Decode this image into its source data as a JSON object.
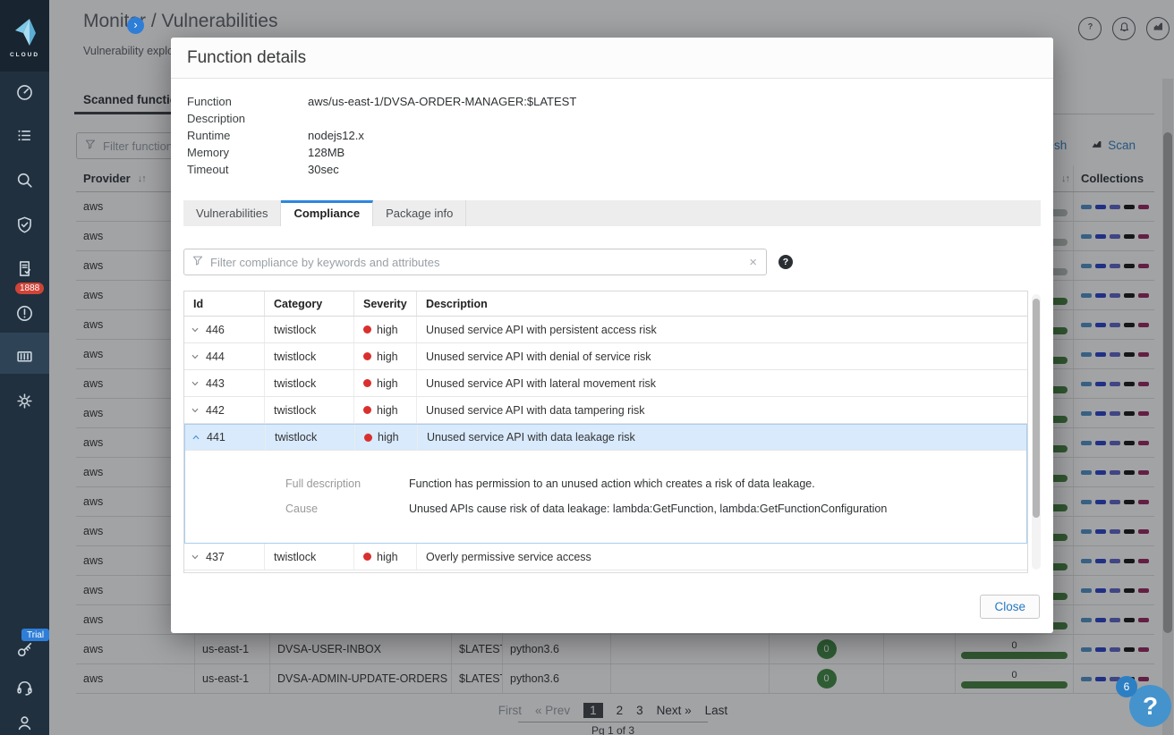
{
  "colors": {
    "accent_blue": "#2b87e0",
    "link_blue": "#2f7fc1",
    "severity_high_red": "#d9302e",
    "success_green": "#3e8a42",
    "bar_green": "#44803f",
    "bar_gray": "#b9c2bd",
    "collections_palette": [
      "#4f91c9",
      "#2840c8",
      "#5c63c8",
      "#141414",
      "#97245d"
    ]
  },
  "sidebar": {
    "logo_label": "CLOUD",
    "expand_chevron": "›",
    "alerts_badge": "1888",
    "trial_badge": "Trial",
    "nav_icons": [
      "gauge-icon",
      "checklist-icon",
      "search-icon",
      "shield-check-icon",
      "document-check-icon",
      "alert-circle-icon",
      "containers-icon",
      "gear-icon"
    ],
    "footer_icons": [
      "key-icon",
      "headset-icon",
      "user-icon"
    ]
  },
  "header": {
    "title": "Monitor / Vulnerabilities",
    "subtitle": "Vulnerability explorer",
    "action_icons": [
      "help-icon",
      "bell-icon",
      "stats-icon"
    ]
  },
  "background": {
    "tab_label": "Scanned functions",
    "filter_placeholder": "Filter functions by keywords and attributes",
    "refresh_label": "Refresh",
    "scan_label": "Scan",
    "table": {
      "provider_header": "Provider",
      "collections_header": "Collections",
      "sort_glyph": "↓↑",
      "rows": [
        {
          "provider": "aws",
          "region": "",
          "name": "",
          "version": "",
          "runtime": "",
          "issues": "",
          "bar": "gray",
          "bar_label": ""
        },
        {
          "provider": "aws",
          "region": "",
          "name": "",
          "version": "",
          "runtime": "",
          "issues": "",
          "bar": "gray",
          "bar_label": ""
        },
        {
          "provider": "aws",
          "region": "",
          "name": "",
          "version": "",
          "runtime": "",
          "issues": "",
          "bar": "gray",
          "bar_label": ""
        },
        {
          "provider": "aws",
          "region": "",
          "name": "",
          "version": "",
          "runtime": "",
          "issues": "",
          "bar": "green",
          "bar_label": ""
        },
        {
          "provider": "aws",
          "region": "",
          "name": "",
          "version": "",
          "runtime": "",
          "issues": "",
          "bar": "green",
          "bar_label": ""
        },
        {
          "provider": "aws",
          "region": "",
          "name": "",
          "version": "",
          "runtime": "",
          "issues": "",
          "bar": "green",
          "bar_label": ""
        },
        {
          "provider": "aws",
          "region": "",
          "name": "",
          "version": "",
          "runtime": "",
          "issues": "",
          "bar": "green",
          "bar_label": ""
        },
        {
          "provider": "aws",
          "region": "",
          "name": "",
          "version": "",
          "runtime": "",
          "issues": "",
          "bar": "green",
          "bar_label": ""
        },
        {
          "provider": "aws",
          "region": "",
          "name": "",
          "version": "",
          "runtime": "",
          "issues": "",
          "bar": "green",
          "bar_label": ""
        },
        {
          "provider": "aws",
          "region": "",
          "name": "",
          "version": "",
          "runtime": "",
          "issues": "",
          "bar": "green",
          "bar_label": ""
        },
        {
          "provider": "aws",
          "region": "",
          "name": "",
          "version": "",
          "runtime": "",
          "issues": "",
          "bar": "green",
          "bar_label": ""
        },
        {
          "provider": "aws",
          "region": "",
          "name": "",
          "version": "",
          "runtime": "",
          "issues": "",
          "bar": "green",
          "bar_label": ""
        },
        {
          "provider": "aws",
          "region": "",
          "name": "",
          "version": "",
          "runtime": "",
          "issues": "",
          "bar": "green",
          "bar_label": ""
        },
        {
          "provider": "aws",
          "region": "",
          "name": "",
          "version": "",
          "runtime": "",
          "issues": "",
          "bar": "green",
          "bar_label": ""
        },
        {
          "provider": "aws",
          "region": "",
          "name": "",
          "version": "",
          "runtime": "",
          "issues": "",
          "bar": "green",
          "bar_label": ""
        },
        {
          "provider": "aws",
          "region": "us-east-1",
          "name": "DVSA-USER-INBOX",
          "version": "$LATEST",
          "runtime": "python3.6",
          "issues": "0",
          "bar": "green",
          "bar_label": "0"
        },
        {
          "provider": "aws",
          "region": "us-east-1",
          "name": "DVSA-ADMIN-UPDATE-ORDERS",
          "version": "$LATEST",
          "runtime": "python3.6",
          "issues": "0",
          "bar": "green",
          "bar_label": "0"
        }
      ]
    },
    "pagination": {
      "first": "First",
      "prev": "« Prev",
      "pages": [
        "1",
        "2",
        "3"
      ],
      "active_page": "1",
      "next": "Next »",
      "last": "Last",
      "status": "Pg 1 of 3"
    }
  },
  "modal": {
    "title": "Function details",
    "details": [
      {
        "label": "Function",
        "value": "aws/us-east-1/DVSA-ORDER-MANAGER:$LATEST"
      },
      {
        "label": "Description",
        "value": ""
      },
      {
        "label": "Runtime",
        "value": "nodejs12.x"
      },
      {
        "label": "Memory",
        "value": "128MB"
      },
      {
        "label": "Timeout",
        "value": "30sec"
      }
    ],
    "tabs": [
      {
        "label": "Vulnerabilities",
        "active": false
      },
      {
        "label": "Compliance",
        "active": true
      },
      {
        "label": "Package info",
        "active": false
      }
    ],
    "filter_placeholder": "Filter compliance by keywords and attributes",
    "clear_glyph": "×",
    "help_glyph": "?",
    "compliance": {
      "headers": [
        "Id",
        "Category",
        "Severity",
        "Description"
      ],
      "detail_labels": {
        "full_description": "Full description",
        "cause": "Cause"
      },
      "rows": [
        {
          "id": "446",
          "category": "twistlock",
          "severity": "high",
          "description": "Unused service API with persistent access risk",
          "expanded": false
        },
        {
          "id": "444",
          "category": "twistlock",
          "severity": "high",
          "description": "Unused service API with denial of service risk",
          "expanded": false
        },
        {
          "id": "443",
          "category": "twistlock",
          "severity": "high",
          "description": "Unused service API with lateral movement risk",
          "expanded": false
        },
        {
          "id": "442",
          "category": "twistlock",
          "severity": "high",
          "description": "Unused service API with data tampering risk",
          "expanded": false
        },
        {
          "id": "441",
          "category": "twistlock",
          "severity": "high",
          "description": "Unused service API with data leakage risk",
          "expanded": true,
          "full_description": "Function has permission to an unused action which creates a risk of data leakage.",
          "cause": "Unused APIs cause risk of data leakage: lambda:GetFunction, lambda:GetFunctionConfiguration"
        },
        {
          "id": "437",
          "category": "twistlock",
          "severity": "high",
          "description": "Overly permissive service access",
          "expanded": false
        }
      ]
    },
    "close_label": "Close"
  },
  "floating_help": {
    "icon": "?",
    "badge": "6"
  }
}
